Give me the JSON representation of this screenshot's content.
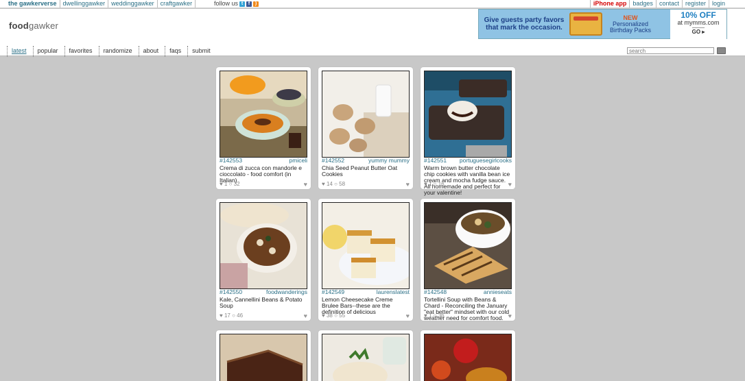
{
  "topbar": {
    "network": [
      "the gawkerverse",
      "dwellinggawker",
      "weddinggawker",
      "craftgawker"
    ],
    "follow_label": "follow us",
    "util_links": [
      "iPhone app",
      "badges",
      "contact",
      "register",
      "login"
    ]
  },
  "logo": {
    "bold": "food",
    "rest": "gawker"
  },
  "ad": {
    "headline": "Give guests party favors that mark the occasion.",
    "new_label": "NEW",
    "product": "Personalized Birthday Packs",
    "offer": "10% OFF",
    "site": "at mymms.com",
    "go": "GO"
  },
  "nav": [
    "latest",
    "popular",
    "favorites",
    "randomize",
    "about",
    "faqs",
    "submit"
  ],
  "search": {
    "placeholder": "search"
  },
  "cards": [
    {
      "id": "#142553",
      "author": "pmiceli",
      "desc": "Crema di zucca con mandorle e cioccolato - food comfort (in Italian)",
      "stats": "♥ 1 ○ 32"
    },
    {
      "id": "#142552",
      "author": "yummy mummy",
      "desc": "Chia Seed Peanut Butter Oat Cookies",
      "stats": "♥ 14  ○ 58"
    },
    {
      "id": "#142551",
      "author": "portuguesegirlcooks",
      "desc": "Warm brown butter chocolate chip cookies with vanilla bean ice cream and mocha fudge sauce. All homemade and perfect for your valentine!",
      "stats": "♥ 1 ○ 16"
    },
    {
      "id": "#142550",
      "author": "foodwanderings",
      "desc": "Kale, Cannellini Beans & Potato Soup",
      "stats": "♥ 17  ○ 46"
    },
    {
      "id": "#142549",
      "author": "laurenslatest",
      "desc": "Lemon Cheesecake Creme Brulee Bars--these are the definition of delicious",
      "stats": "♥ 38 ○ 55"
    },
    {
      "id": "#142548",
      "author": "annieseats",
      "desc": "Tortellini Soup with Beans & Chard - Reconciling the January \"eat better\" mindset with our cold weather need for comfort food.",
      "stats": "♥ 1 ○ 36"
    }
  ],
  "colors": {
    "link": "#2a6f86",
    "background": "#c8c8c8",
    "iphone": "#d40000"
  }
}
